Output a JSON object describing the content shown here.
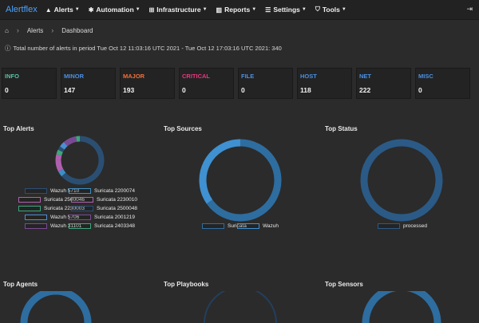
{
  "nav": {
    "brand": "Alertflex",
    "items": [
      {
        "label": "Alerts",
        "icon": "warning-icon"
      },
      {
        "label": "Automation",
        "icon": "gear-icon"
      },
      {
        "label": "Infrastructure",
        "icon": "network-icon"
      },
      {
        "label": "Reports",
        "icon": "bar-chart-icon"
      },
      {
        "label": "Settings",
        "icon": "sliders-icon"
      },
      {
        "label": "Tools",
        "icon": "shield-icon"
      }
    ],
    "logout_icon": "logout-icon"
  },
  "breadcrumb": {
    "items": [
      "Alerts",
      "Dashboard"
    ]
  },
  "summary": {
    "text": "Total number of alerts in period Tue Oct 12 11:03:16 UTC 2021 - Tue Oct 12 17:03:16 UTC 2021: 340"
  },
  "cards": [
    {
      "label": "INFO",
      "value": "0",
      "color": "#5bc0a8"
    },
    {
      "label": "MINOR",
      "value": "147",
      "color": "#4a90e2"
    },
    {
      "label": "MAJOR",
      "value": "193",
      "color": "#f0703b"
    },
    {
      "label": "CRITICAL",
      "value": "0",
      "color": "#e53980"
    },
    {
      "label": "FILE",
      "value": "0",
      "color": "#4a90e2"
    },
    {
      "label": "HOST",
      "value": "118",
      "color": "#4a90e2"
    },
    {
      "label": "NET",
      "value": "222",
      "color": "#4a90e2"
    },
    {
      "label": "MISC",
      "value": "0",
      "color": "#4a90e2"
    }
  ],
  "sections": {
    "top_alerts": "Top Alerts",
    "top_sources": "Top Sources",
    "top_status": "Top Status",
    "top_agents": "Top Agents",
    "top_playbooks": "Top Playbooks",
    "top_sensors": "Top Sensors"
  },
  "chart_data": [
    {
      "type": "pie",
      "title": "Top Alerts",
      "categories": [
        "Wazuh 5710",
        "Suricata 2200074",
        "Suricata 2500046",
        "Suricata 2230010",
        "Suricata 2230003",
        "Suricata 2500048",
        "Wazuh 5706",
        "Suricata 2001219",
        "Wazuh 31101",
        "Suricata 2403348"
      ],
      "values": [
        200,
        12,
        25,
        12,
        10,
        8,
        12,
        18,
        10,
        8
      ],
      "colors": [
        "#2b4f73",
        "#3d8fc4",
        "#b05fae",
        "#b05fae",
        "#3fa57c",
        "#2b4f73",
        "#4a8fd0",
        "#7a4a94",
        "#7a4a94",
        "#3fa57c"
      ]
    },
    {
      "type": "pie",
      "title": "Top Sources",
      "categories": [
        "Suricata",
        "Wazuh"
      ],
      "values": [
        222,
        118
      ],
      "colors": [
        "#2e6da0",
        "#3f91d1"
      ]
    },
    {
      "type": "pie",
      "title": "Top Status",
      "categories": [
        "processed"
      ],
      "values": [
        340
      ],
      "colors": [
        "#2b5a86"
      ]
    }
  ]
}
